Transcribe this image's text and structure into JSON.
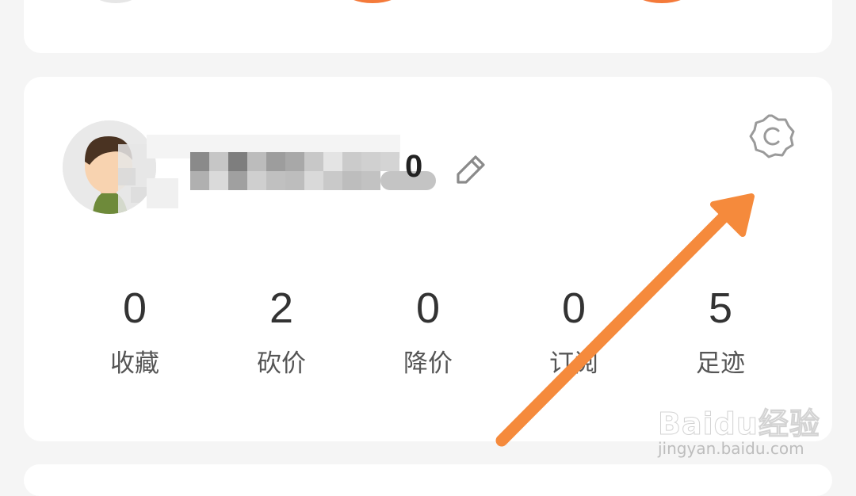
{
  "profile": {
    "username_suffix": "0",
    "avatar_icon": "user-avatar",
    "edit_icon": "pencil-icon",
    "settings_icon": "gear-icon"
  },
  "stats": [
    {
      "value": "0",
      "label": "收藏"
    },
    {
      "value": "2",
      "label": "砍价"
    },
    {
      "value": "0",
      "label": "降价"
    },
    {
      "value": "0",
      "label": "订阅"
    },
    {
      "value": "5",
      "label": "足迹"
    }
  ],
  "watermark": {
    "brand": "Baidu经验",
    "url": "jingyan.baidu.com"
  },
  "colors": {
    "accent": "#f47a3a",
    "arrow": "#f58a3c",
    "card": "#ffffff",
    "background": "#f5f5f5"
  }
}
